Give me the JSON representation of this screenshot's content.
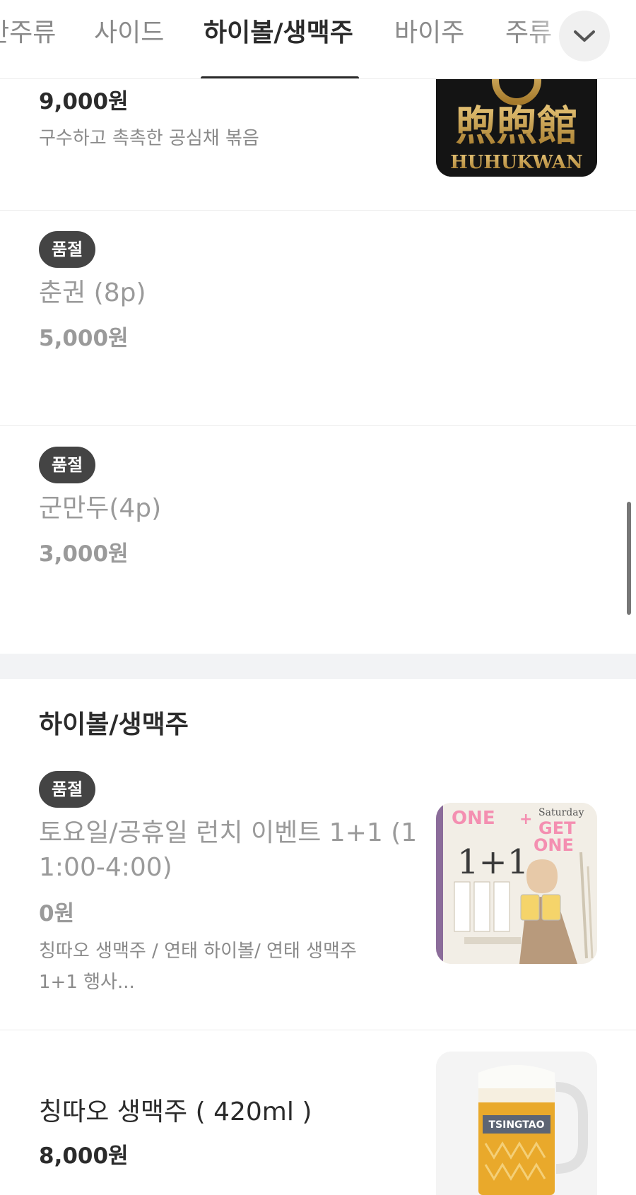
{
  "tabs": {
    "items": [
      "안주류",
      "사이드",
      "하이볼/생맥주",
      "바이주",
      "주류"
    ],
    "active": "하이볼/생맥주"
  },
  "menu_items": [
    {
      "price": "9,000원",
      "description": "구수하고 촉촉한 공심채 볶음",
      "image": {
        "logo_chars": "煦煦館",
        "logo_text": "HUHUKWAN"
      }
    },
    {
      "badge": "품절",
      "name": "춘권 (8p)",
      "price": "5,000원"
    },
    {
      "badge": "품절",
      "name": "군만두(4p)",
      "price": "3,000원"
    }
  ],
  "section": {
    "title": "하이볼/생맥주",
    "items": [
      {
        "badge": "품절",
        "name_line1": "토요일/공휴일 런치 이벤트 1+1 (1",
        "name_line2": "1:00-4:00)",
        "price": "0원",
        "desc_line1": "칭따오 생맥주 / 연태 하이볼/ 연태 생맥주",
        "desc_line2": "1+1 행사...",
        "image": {
          "text_one": "ONE",
          "text_plus": "+",
          "text_get": "GET",
          "text_one2": "ONE",
          "text_saturday": "Saturday",
          "text_big": "1+1"
        }
      },
      {
        "name": "칭따오 생맥주 ( 420ml )",
        "price": "8,000원",
        "image": {
          "brand": "TSINGTAO"
        }
      }
    ]
  },
  "colors": {
    "accent": "#2b2b2b",
    "badge": "#444444",
    "sold_out_text": "#9a9a9a"
  }
}
